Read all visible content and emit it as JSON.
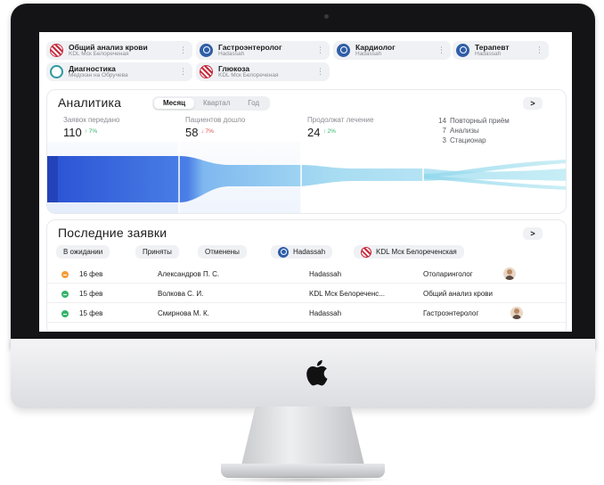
{
  "services": [
    {
      "title": "Общий анализ крови",
      "subtitle": "KDL Мск Белореченая",
      "logo": "kdl"
    },
    {
      "title": "Гастроэнтеролог",
      "subtitle": "Hadassah",
      "logo": "hadassah"
    },
    {
      "title": "Кардиолог",
      "subtitle": "Hadassah",
      "logo": "hadassah"
    },
    {
      "title": "Терапевт",
      "subtitle": "Hadassah",
      "logo": "hadassah"
    },
    {
      "title": "Диагностика",
      "subtitle": "Медскан на Обручева",
      "logo": "medscan"
    },
    {
      "title": "Глюкоза",
      "subtitle": "KDL Мск Белореченая",
      "logo": "kdl"
    }
  ],
  "more_icon": "⋮",
  "analytics": {
    "title": "Аналитика",
    "periods": [
      "Месяц",
      "Квартал",
      "Год"
    ],
    "active_period": "Месяц",
    "next_icon": ">",
    "metrics": [
      {
        "label": "Заявок передано",
        "value": "110",
        "change": "↑ 7%",
        "trend": "up"
      },
      {
        "label": "Пациентов дошло",
        "value": "58",
        "change": "↓ 7%",
        "trend": "down"
      },
      {
        "label": "Продолжат лечение",
        "value": "24",
        "change": "↑ 2%",
        "trend": "up"
      }
    ],
    "breakdown": [
      {
        "count": "14",
        "label": "Повторный приём"
      },
      {
        "count": "7",
        "label": "Анализы"
      },
      {
        "count": "3",
        "label": "Стационар"
      }
    ],
    "colors": {
      "primary": "#2f5bd8",
      "mid": "#7fb8f0",
      "light": "#9fe0ee"
    }
  },
  "requests": {
    "title": "Последние заявки",
    "next_icon": ">",
    "filters": [
      {
        "label": "В ожидании"
      },
      {
        "label": "Приняты"
      },
      {
        "label": "Отменены"
      },
      {
        "label": "Hadassah",
        "logo": "hadassah"
      },
      {
        "label": "KDL Мск Белореченская",
        "logo": "kdl"
      }
    ],
    "rows": [
      {
        "status": "pending",
        "date": "16 фев",
        "patient": "Александров П. С.",
        "clinic": "Hadassah",
        "service": "Отоларинголог",
        "avatar": true
      },
      {
        "status": "done",
        "date": "15 фев",
        "patient": "Волкова С. И.",
        "clinic": "KDL Мск Белореченс...",
        "service": "Общий анализ крови",
        "avatar": false
      },
      {
        "status": "done",
        "date": "15 фев",
        "patient": "Смирнова М. К.",
        "clinic": "Hadassah",
        "service": "Гастроэнтеролог",
        "avatar": true
      }
    ]
  }
}
